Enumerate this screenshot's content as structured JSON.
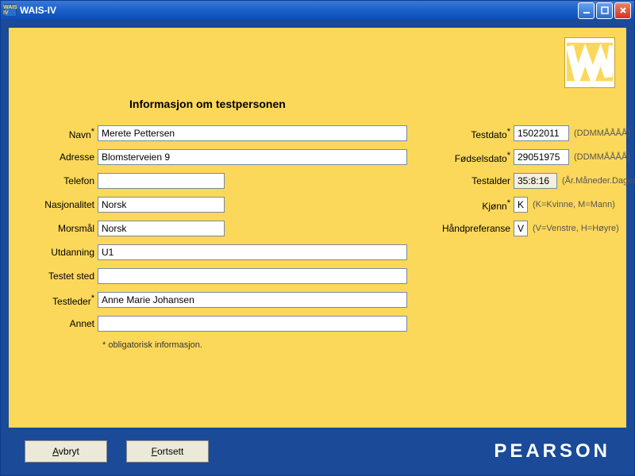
{
  "window": {
    "title": "WAIS-IV"
  },
  "panel": {
    "heading": "Informasjon om testpersonen",
    "mandatory_note": "* obligatorisk informasjon."
  },
  "left": {
    "name_label": "Navn",
    "name_value": "Merete Pettersen",
    "address_label": "Adresse",
    "address_value": "Blomsterveien 9",
    "phone_label": "Telefon",
    "phone_value": "",
    "nationality_label": "Nasjonalitet",
    "nationality_value": "Norsk",
    "language_label": "Morsmål",
    "language_value": "Norsk",
    "education_label": "Utdanning",
    "education_value": "U1",
    "testsite_label": "Testet sted",
    "testsite_value": "",
    "examiner_label": "Testleder",
    "examiner_value": "Anne Marie Johansen",
    "other_label": "Annet",
    "other_value": ""
  },
  "right": {
    "testdate_label": "Testdato",
    "testdate_value": "15022011",
    "testdate_hint": "(DDMMÅÅÅÅ)",
    "birthdate_label": "Fødselsdato",
    "birthdate_value": "29051975",
    "birthdate_hint": "(DDMMÅÅÅÅ)",
    "testage_label": "Testalder",
    "testage_value": "35:8:16",
    "testage_hint": "(År.Måneder.Dager)",
    "gender_label": "Kjønn",
    "gender_value": "K",
    "gender_hint": "(K=Kvinne, M=Mann)",
    "hand_label": "Håndpreferanse",
    "hand_value": "V",
    "hand_hint": "(V=Venstre, H=Høyre)"
  },
  "footer": {
    "cancel": "Avbryt",
    "continue": "Fortsett",
    "brand": "PEARSON"
  }
}
